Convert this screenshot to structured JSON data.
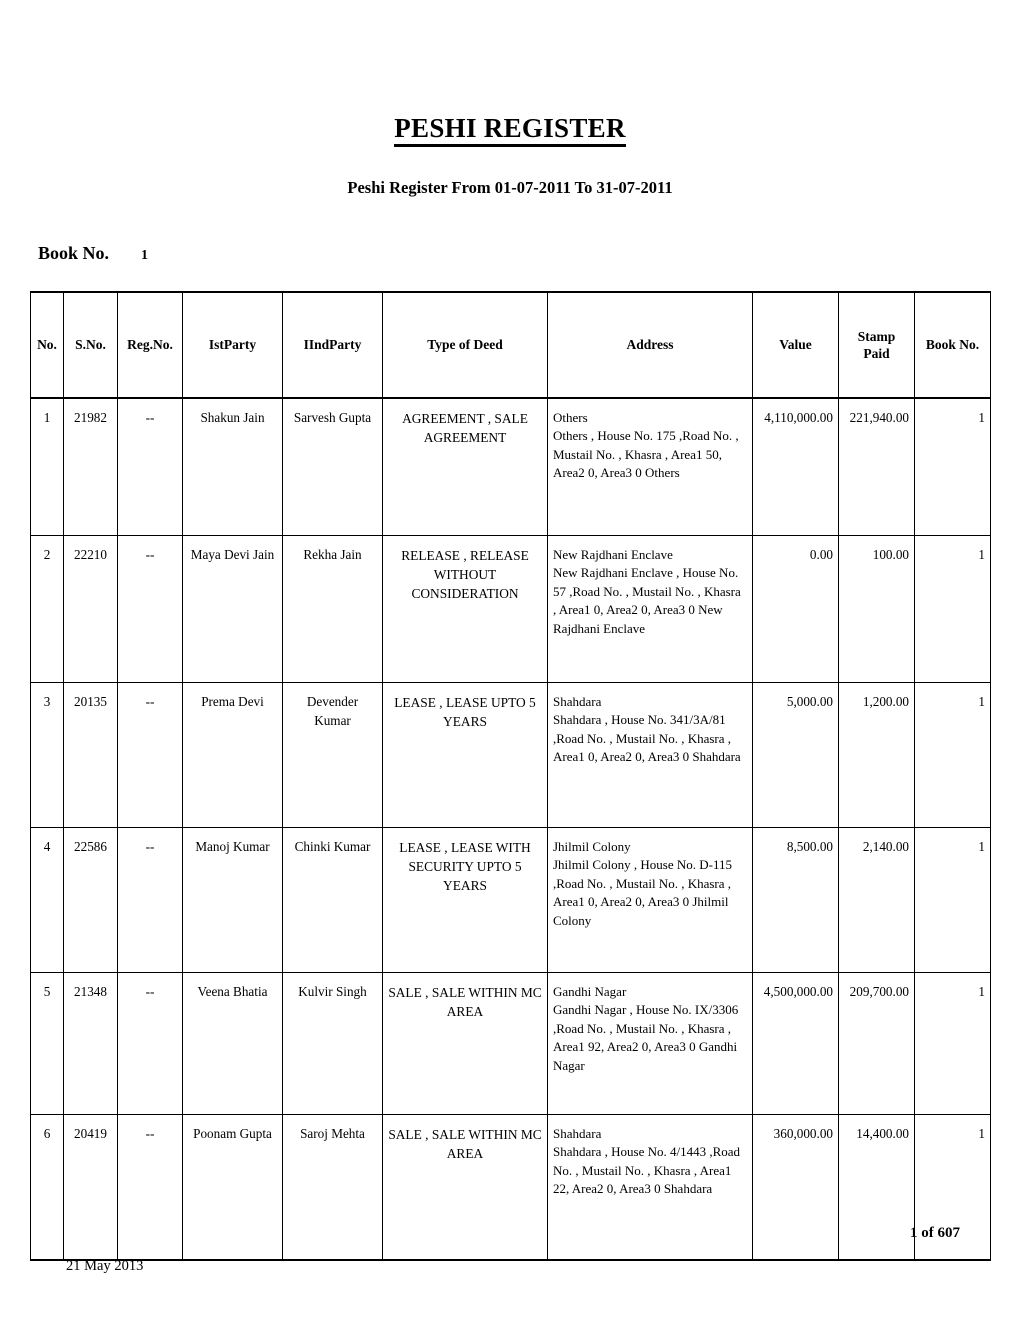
{
  "document": {
    "title": "PESHI REGISTER",
    "subtitle": "Peshi Register From 01-07-2011 To 31-07-2011",
    "book_no_label": "Book No.",
    "book_no_value": "1"
  },
  "table": {
    "headers": {
      "no": "No.",
      "s_no": "S.No.",
      "reg_no": "Reg.No.",
      "ist_party": "IstParty",
      "iind_party": "IIndParty",
      "type_of_deed": "Type of Deed",
      "address": "Address",
      "value": "Value",
      "stamp_paid_line1": "Stamp",
      "stamp_paid_line2": "Paid",
      "book_no": "Book No."
    },
    "rows": [
      {
        "no": "1",
        "s_no": "21982",
        "reg_no": "--",
        "ist_party": "Shakun Jain",
        "iind_party": "Sarvesh Gupta",
        "type_of_deed": "AGREEMENT , SALE AGREEMENT",
        "address": "Others\nOthers , House No. 175 ,Road No. , Mustail No. , Khasra , Area1        50, Area2        0, Area3        0  Others",
        "value": "4,110,000.00",
        "stamp_paid": "221,940.00",
        "book_no": "1"
      },
      {
        "no": "2",
        "s_no": "22210",
        "reg_no": "--",
        "ist_party": "Maya Devi Jain",
        "iind_party": "Rekha Jain",
        "type_of_deed": "RELEASE , RELEASE WITHOUT CONSIDERATION",
        "address": "New Rajdhani Enclave\nNew Rajdhani Enclave        , House No. 57 ,Road No. , Mustail No. , Khasra , Area1        0, Area2        0, Area3        0  New Rajdhani Enclave",
        "value": "0.00",
        "stamp_paid": "100.00",
        "book_no": "1"
      },
      {
        "no": "3",
        "s_no": "20135",
        "reg_no": "--",
        "ist_party": "Prema Devi",
        "iind_party": "Devender Kumar",
        "type_of_deed": "LEASE , LEASE UPTO 5 YEARS",
        "address": "Shahdara\nShahdara , House No. 341/3A/81 ,Road No. , Mustail No. , Khasra , Area1        0, Area2        0, Area3 0  Shahdara",
        "value": "5,000.00",
        "stamp_paid": "1,200.00",
        "book_no": "1"
      },
      {
        "no": "4",
        "s_no": "22586",
        "reg_no": "--",
        "ist_party": "Manoj Kumar",
        "iind_party": "Chinki Kumar",
        "type_of_deed": "LEASE , LEASE WITH SECURITY UPTO 5 YEARS",
        "address": "Jhilmil Colony\nJhilmil Colony , House No. D-115 ,Road No. , Mustail No. , Khasra , Area1        0, Area2        0, Area3 0  Jhilmil Colony",
        "value": "8,500.00",
        "stamp_paid": "2,140.00",
        "book_no": "1"
      },
      {
        "no": "5",
        "s_no": "21348",
        "reg_no": "--",
        "ist_party": "Veena Bhatia",
        "iind_party": "Kulvir Singh",
        "type_of_deed": "SALE , SALE WITHIN MC AREA",
        "address": "Gandhi Nagar\nGandhi Nagar , House No. IX/3306 ,Road No. , Mustail No. , Khasra , Area1        92, Area2        0, Area3 0  Gandhi Nagar",
        "value": "4,500,000.00",
        "stamp_paid": "209,700.00",
        "book_no": "1"
      },
      {
        "no": "6",
        "s_no": "20419",
        "reg_no": "--",
        "ist_party": "Poonam Gupta",
        "iind_party": "Saroj Mehta",
        "type_of_deed": "SALE , SALE WITHIN MC AREA",
        "address": "Shahdara\nShahdara , House No. 4/1443 ,Road No. , Mustail No. , Khasra , Area1        22, Area2        0, Area3        0 Shahdara",
        "value": "360,000.00",
        "stamp_paid": "14,400.00",
        "book_no": "1"
      }
    ]
  },
  "footer": {
    "page_indicator": "1  of  607",
    "date": "21  May  2013"
  }
}
